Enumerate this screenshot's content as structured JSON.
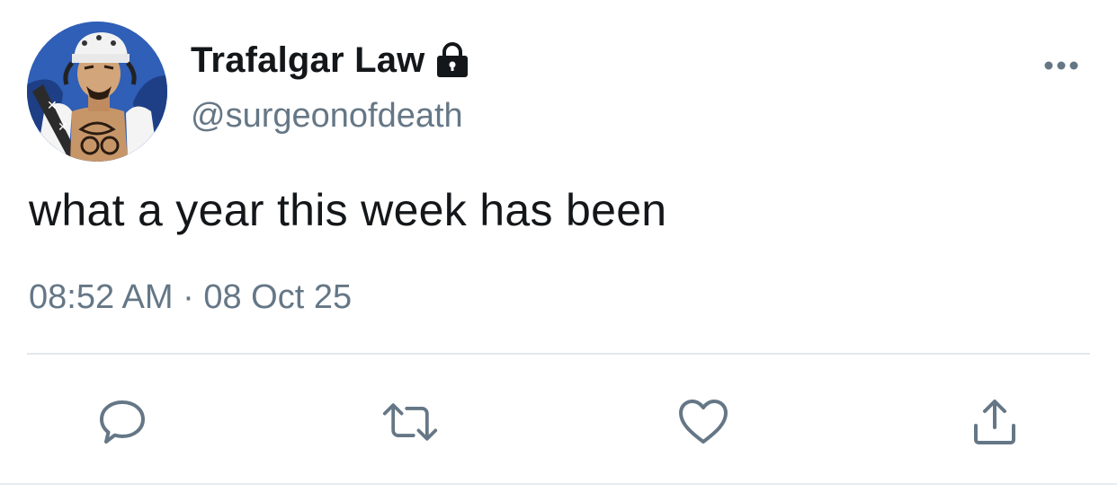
{
  "tweet": {
    "display_name": "Trafalgar Law",
    "handle": "@surgeonofdeath",
    "text": "what a year this week has been",
    "timestamp": "08:52 AM · 08 Oct 25",
    "protected_icon": "lock-icon",
    "avatar_icon": "anime-character-avatar"
  },
  "actions": [
    {
      "icon": "reply-icon"
    },
    {
      "icon": "retweet-icon"
    },
    {
      "icon": "like-icon"
    },
    {
      "icon": "share-icon"
    }
  ],
  "colors": {
    "text_primary": "#14171a",
    "text_secondary": "#657786",
    "divider": "#e1e8ed",
    "icon": "#657786"
  }
}
